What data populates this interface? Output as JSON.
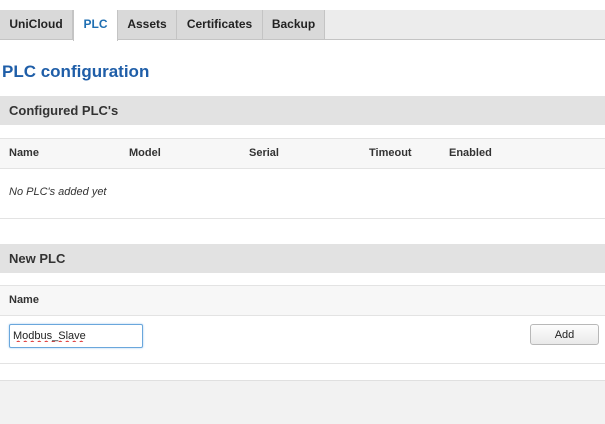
{
  "tabs": [
    {
      "label": "UniCloud"
    },
    {
      "label": "PLC"
    },
    {
      "label": "Assets"
    },
    {
      "label": "Certificates"
    },
    {
      "label": "Backup"
    }
  ],
  "active_tab": "PLC",
  "page_title": "PLC configuration",
  "configured_section": {
    "title": "Configured PLC's",
    "columns": [
      "Name",
      "Model",
      "Serial",
      "Timeout",
      "Enabled"
    ],
    "empty_message": "No PLC's added yet"
  },
  "new_section": {
    "title": "New PLC",
    "name_label": "Name",
    "name_value": "Modbus_Slave",
    "add_label": "Add"
  },
  "colors": {
    "accent": "#1f6fb2",
    "title": "#1f5ea8"
  }
}
